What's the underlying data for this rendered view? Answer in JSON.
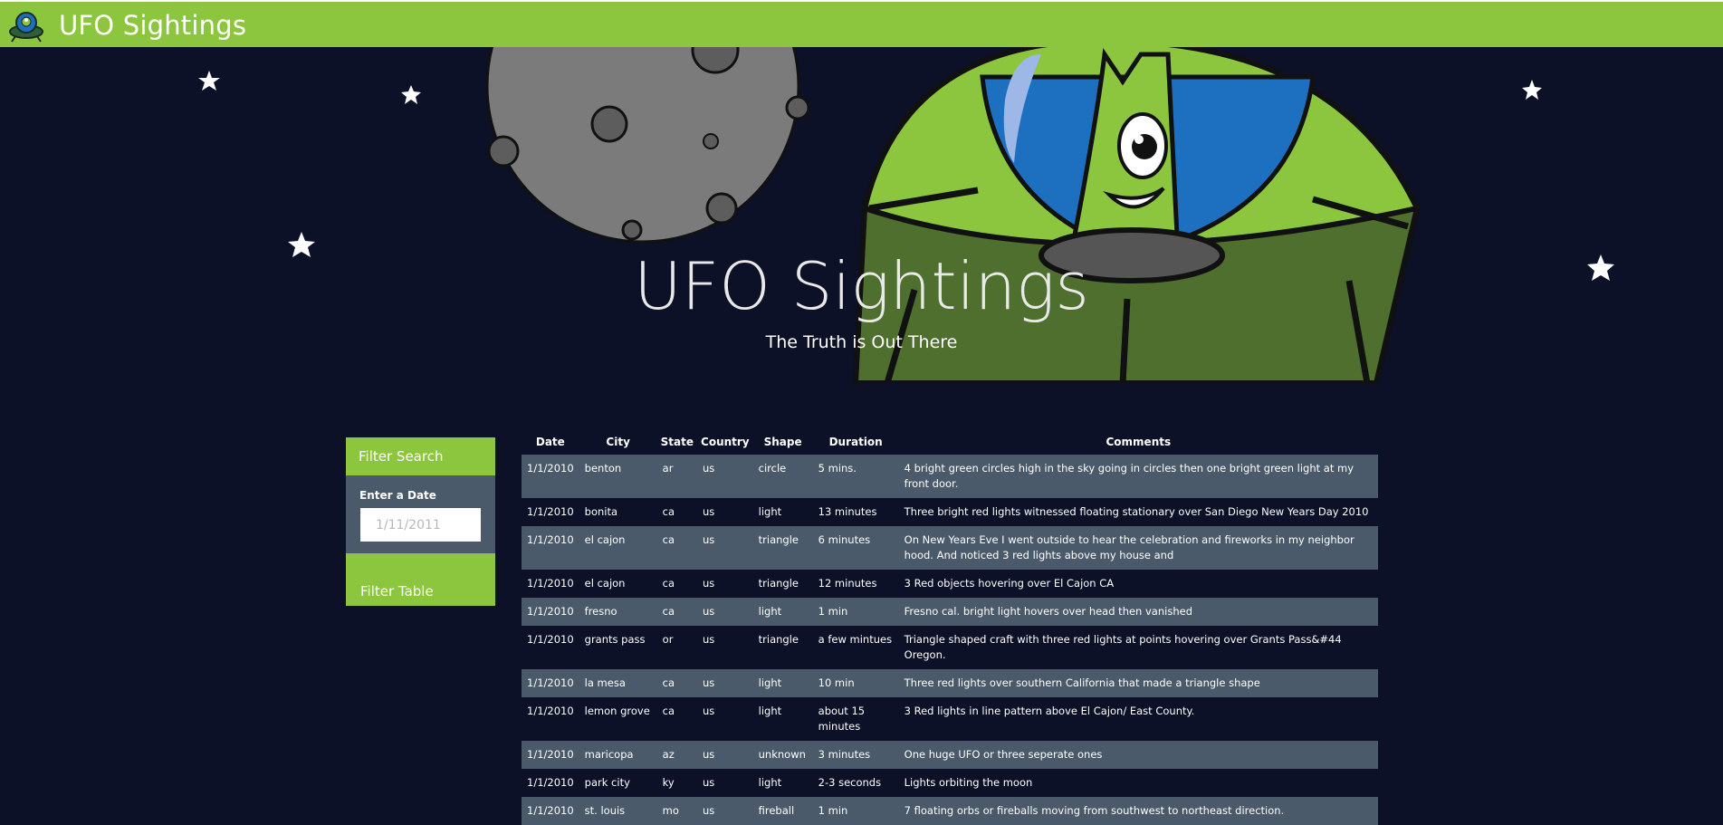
{
  "navbar": {
    "title": "UFO Sightings",
    "logo_icon": "ufo-logo-icon"
  },
  "hero": {
    "title": "UFO Sightings",
    "subtitle": "The Truth is Out There"
  },
  "filter": {
    "header": "Filter Search",
    "date_label": "Enter a Date",
    "date_placeholder": "1/11/2011",
    "button_label": "Filter Table"
  },
  "table": {
    "headers": [
      "Date",
      "City",
      "State",
      "Country",
      "Shape",
      "Duration",
      "Comments"
    ],
    "rows": [
      [
        "1/1/2010",
        "benton",
        "ar",
        "us",
        "circle",
        "5 mins.",
        "4 bright green circles high in the sky going in circles then one bright green light at my front door."
      ],
      [
        "1/1/2010",
        "bonita",
        "ca",
        "us",
        "light",
        "13 minutes",
        "Three bright red lights witnessed floating stationary over San Diego New Years Day 2010"
      ],
      [
        "1/1/2010",
        "el cajon",
        "ca",
        "us",
        "triangle",
        "6 minutes",
        "On New Years Eve I went outside to hear the celebration and fireworks in my neighbor hood. And noticed 3 red lights above my house and"
      ],
      [
        "1/1/2010",
        "el cajon",
        "ca",
        "us",
        "triangle",
        "12 minutes",
        "3 Red objects hovering over El Cajon CA"
      ],
      [
        "1/1/2010",
        "fresno",
        "ca",
        "us",
        "light",
        "1 min",
        "Fresno cal. bright light hovers over head then vanished"
      ],
      [
        "1/1/2010",
        "grants pass",
        "or",
        "us",
        "triangle",
        "a few mintues",
        "Triangle shaped craft with three red lights at points hovering over Grants Pass&#44 Oregon."
      ],
      [
        "1/1/2010",
        "la mesa",
        "ca",
        "us",
        "light",
        "10 min",
        "Three red lights over southern California that made a triangle shape"
      ],
      [
        "1/1/2010",
        "lemon grove",
        "ca",
        "us",
        "light",
        "about 15 minutes",
        "3 Red lights in line pattern above El Cajon/ East County."
      ],
      [
        "1/1/2010",
        "maricopa",
        "az",
        "us",
        "unknown",
        "3 minutes",
        "One huge UFO or three seperate ones"
      ],
      [
        "1/1/2010",
        "park city",
        "ky",
        "us",
        "light",
        "2-3 seconds",
        "Lights orbiting the moon"
      ],
      [
        "1/1/2010",
        "st. louis",
        "mo",
        "us",
        "fireball",
        "1 min",
        "7 floating orbs or fireballs moving from southwest to northeast direction."
      ]
    ]
  },
  "colors": {
    "nav_green": "#8cc63f",
    "background": "#0c1128",
    "row_gray": "#4a5a6b"
  }
}
